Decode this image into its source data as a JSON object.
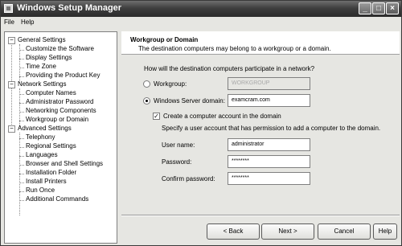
{
  "window": {
    "title": "Windows Setup Manager"
  },
  "menubar": {
    "items": [
      "File",
      "Help"
    ]
  },
  "tree": {
    "groups": [
      {
        "label": "General Settings",
        "toggle": "−",
        "items": [
          "Customize the Software",
          "Display Settings",
          "Time Zone",
          "Providing the Product Key"
        ]
      },
      {
        "label": "Network Settings",
        "toggle": "−",
        "items": [
          "Computer Names",
          "Administrator Password",
          "Networking Components",
          "Workgroup or Domain"
        ]
      },
      {
        "label": "Advanced Settings",
        "toggle": "−",
        "items": [
          "Telephony",
          "Regional Settings",
          "Languages",
          "Browser and Shell Settings",
          "Installation Folder",
          "Install Printers",
          "Run Once",
          "Additional Commands"
        ]
      }
    ],
    "selected": "Workgroup or Domain"
  },
  "page": {
    "title": "Workgroup or Domain",
    "description": "The destination computers may belong to a workgroup or a domain.",
    "question": "How will the destination computers participate in a network?",
    "workgroup": {
      "label": "Workgroup:",
      "value": "WORKGROUP",
      "selected": false
    },
    "domain": {
      "label": "Windows Server domain:",
      "value": "examcram.com",
      "selected": true
    },
    "create_account": {
      "label": "Create a computer account in the domain",
      "checked": true
    },
    "specify_text": "Specify a user account that has permission to add a computer to the domain.",
    "username": {
      "label": "User name:",
      "value": "administrator"
    },
    "password": {
      "label": "Password:",
      "value": "********"
    },
    "confirm": {
      "label": "Confirm password:",
      "value": "********"
    }
  },
  "buttons": {
    "back": "< Back",
    "next": "Next >",
    "cancel": "Cancel",
    "help": "Help"
  }
}
